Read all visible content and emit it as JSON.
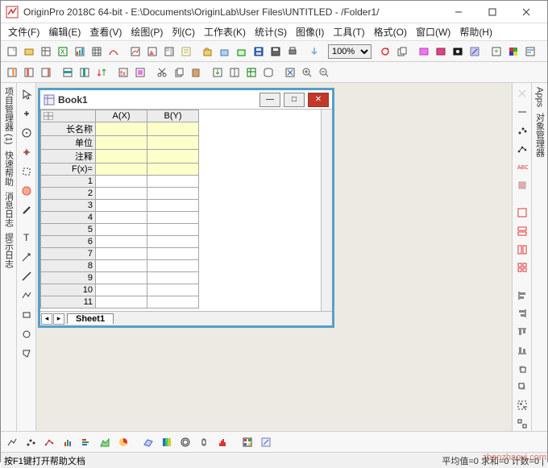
{
  "title": "OriginPro 2018C 64-bit - E:\\Documents\\OriginLab\\User Files\\UNTITLED - /Folder1/",
  "menus": [
    "文件(F)",
    "编辑(E)",
    "查看(V)",
    "绘图(P)",
    "列(C)",
    "工作表(K)",
    "统计(S)",
    "图像(I)",
    "工具(T)",
    "格式(O)",
    "窗口(W)",
    "帮助(H)"
  ],
  "zoom": "100%",
  "book": {
    "title": "Book1",
    "cols": [
      "A(X)",
      "B(Y)"
    ],
    "meta_rows": [
      "长名称",
      "单位",
      "注释",
      "F(x)="
    ],
    "row_numbers": [
      "1",
      "2",
      "3",
      "4",
      "5",
      "6",
      "7",
      "8",
      "9",
      "10",
      "11"
    ],
    "sheet": "Sheet1"
  },
  "left_panels": [
    "项目管理器 (1)",
    "快速帮助",
    "消息日志",
    "提示日志"
  ],
  "right_panels": [
    "Apps",
    "对象管理器"
  ],
  "status_left": "按F1键打开帮助文档",
  "status_right": "平均值=0 求和=0 计数=0 |"
}
